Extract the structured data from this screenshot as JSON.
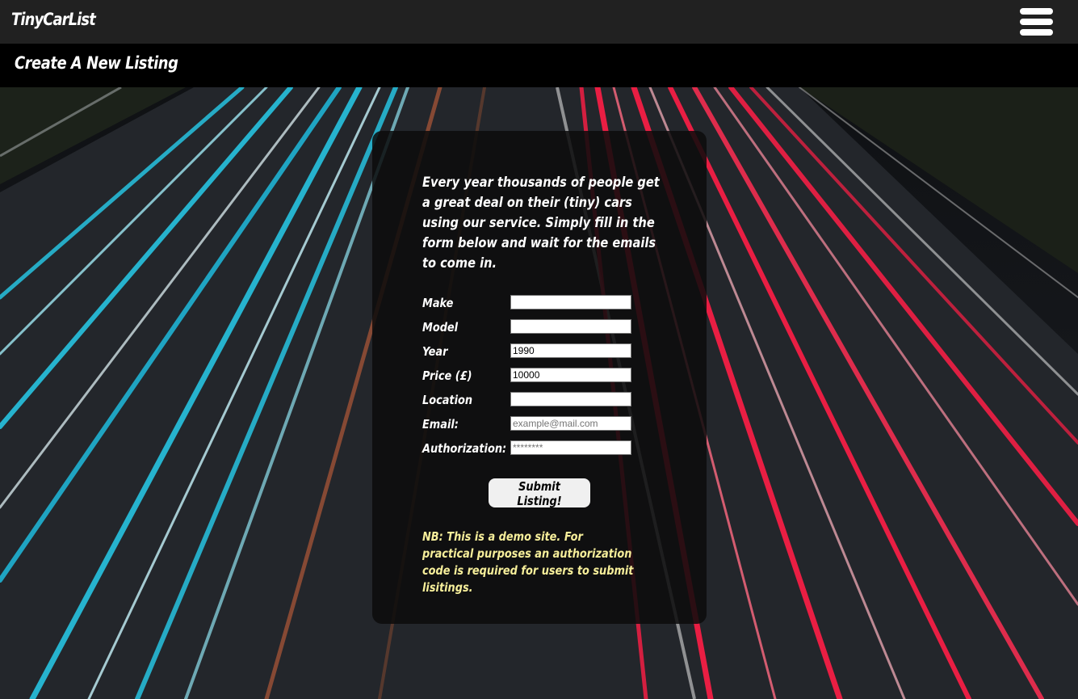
{
  "app": {
    "brand": "TinyCarList",
    "menu_icon": "hamburger-menu-icon"
  },
  "header": {
    "page_title": "Create A New Listing"
  },
  "card": {
    "intro": "Every year thousands of people get a great deal on their (tiny) cars using our service. Simply fill in the form below and wait for the emails to come in.",
    "fields": {
      "make": {
        "label": "Make",
        "value": ""
      },
      "model": {
        "label": "Model",
        "value": ""
      },
      "year": {
        "label": "Year",
        "value": "1990"
      },
      "price": {
        "label": "Price (£)",
        "value": "10000"
      },
      "location": {
        "label": "Location",
        "value": ""
      },
      "email": {
        "label": "Email:",
        "value": "",
        "placeholder": "example@mail.com"
      },
      "authorization": {
        "label": "Authorization:",
        "value": "",
        "placeholder": "********"
      }
    },
    "submit_label": "Submit Listing!",
    "note": "NB: This is a demo site. For practical purposes an authorization code is required for users to submit lisitings."
  },
  "colors": {
    "topbar": "#212121",
    "subbar": "#000000",
    "note_text": "#f6ee9a",
    "cyan_trails": "#27c3e0",
    "red_trails": "#ff1e46"
  }
}
